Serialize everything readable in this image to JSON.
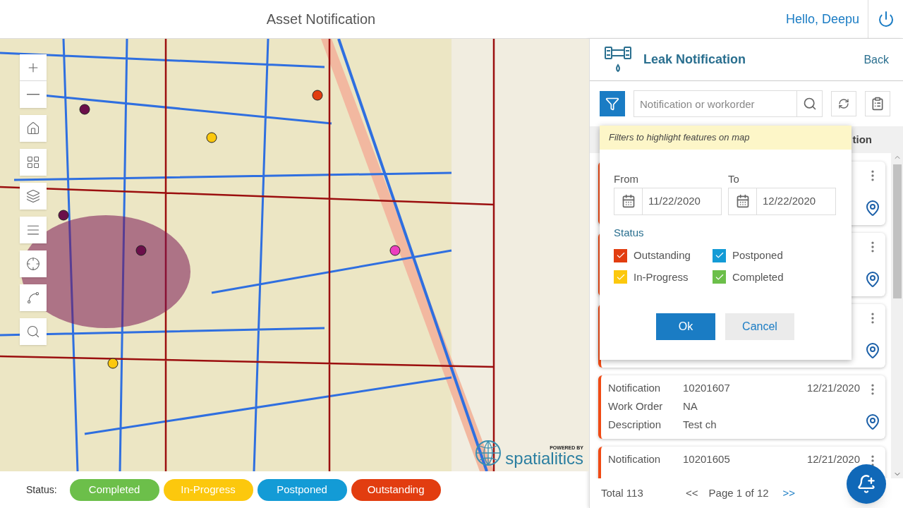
{
  "header": {
    "title": "Asset Notification",
    "greeting": "Hello, Deepu"
  },
  "map": {
    "kind": "picture",
    "tools": [
      {
        "kind": "zoom-in"
      },
      {
        "kind": "zoom-out"
      },
      {
        "kind": "home"
      },
      {
        "kind": "basemap"
      },
      {
        "kind": "layers"
      },
      {
        "kind": "legend"
      },
      {
        "kind": "locate"
      },
      {
        "kind": "measure"
      },
      {
        "kind": "search"
      }
    ],
    "logo": {
      "caption": "POWERED BY",
      "name": "spatialitics"
    }
  },
  "status_bar": {
    "label": "Status:",
    "items": [
      {
        "label": "Completed",
        "color": "#6cbf4a"
      },
      {
        "label": "In-Progress",
        "color": "#fcc80d"
      },
      {
        "label": "Postponed",
        "color": "#139bd6"
      },
      {
        "label": "Outstanding",
        "color": "#e23d10"
      }
    ]
  },
  "panel": {
    "title": "Leak Notification",
    "back": "Back",
    "search": {
      "placeholder": "Notification or workorder"
    },
    "column_header": "tion",
    "cards": [
      {
        "kind": "covered"
      },
      {
        "kind": "covered"
      },
      {
        "kind": "covered"
      },
      {
        "kind": "full",
        "notification_label": "Notification",
        "notification": "10201607",
        "date": "12/21/2020",
        "workorder_label": "Work Order",
        "workorder": "NA",
        "description_label": "Description",
        "description": "Test ch"
      },
      {
        "kind": "full",
        "notification_label": "Notification",
        "notification": "10201605",
        "date": "12/21/2020"
      }
    ],
    "footer": {
      "total": "Total 113",
      "prev": "<<",
      "page": "Page 1 of 12",
      "next": ">>"
    }
  },
  "filter_popup": {
    "hint": "Filters to highlight features on map",
    "from_label": "From",
    "from": "11/22/2020",
    "to_label": "To",
    "to": "12/22/2020",
    "status_label": "Status",
    "statuses": [
      {
        "label": "Outstanding",
        "checked": true,
        "color": "#e23d10"
      },
      {
        "label": "Postponed",
        "checked": true,
        "color": "#139bd6"
      },
      {
        "label": "In-Progress",
        "checked": true,
        "color": "#fcc80d"
      },
      {
        "label": "Completed",
        "checked": true,
        "color": "#6cbf4a"
      }
    ],
    "ok": "Ok",
    "cancel": "Cancel"
  }
}
